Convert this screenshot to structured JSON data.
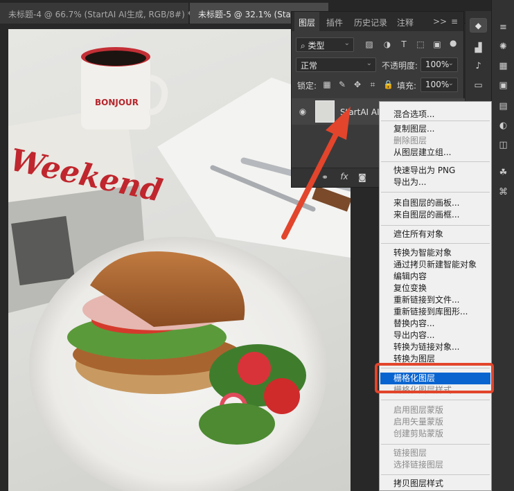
{
  "doc_tabs": [
    {
      "label": "未标题-4 @ 66.7% (StartAI AI生成, RGB/8#) *",
      "close": "×"
    },
    {
      "label": "未标题-5 @ 32.1% (StartAI"
    }
  ],
  "layers_panel": {
    "tabs": [
      "图层",
      "插件",
      "历史记录",
      "注释"
    ],
    "more": ">>",
    "filter": "类型",
    "blend_mode": "正常",
    "opacity_label": "不透明度:",
    "opacity_value": "100%",
    "lock_label": "锁定:",
    "fill_label": "填充:",
    "fill_value": "100%",
    "layer_name": "StartAI AI生",
    "footer_fx": "fx"
  },
  "context_menu": {
    "items": [
      {
        "label": "混合选项...",
        "enabled": true
      },
      {
        "label": "复制图层...",
        "enabled": true
      },
      {
        "label": "删除图层",
        "enabled": false
      },
      {
        "label": "从图层建立组...",
        "enabled": true
      },
      {
        "label": "快速导出为 PNG",
        "enabled": true
      },
      {
        "label": "导出为...",
        "enabled": true
      },
      {
        "label": "来自图层的画板...",
        "enabled": true
      },
      {
        "label": "来自图层的画框...",
        "enabled": true
      },
      {
        "label": "遮住所有对象",
        "enabled": true
      },
      {
        "label": "转换为智能对象",
        "enabled": true
      },
      {
        "label": "通过拷贝新建智能对象",
        "enabled": true
      },
      {
        "label": "编辑内容",
        "enabled": true
      },
      {
        "label": "复位变换",
        "enabled": true
      },
      {
        "label": "重新链接到文件...",
        "enabled": true
      },
      {
        "label": "重新链接到库图形...",
        "enabled": true
      },
      {
        "label": "替换内容...",
        "enabled": true
      },
      {
        "label": "导出内容...",
        "enabled": true
      },
      {
        "label": "转换为链接对象...",
        "enabled": true
      },
      {
        "label": "转换为图层",
        "enabled": true
      },
      {
        "label": "栅格化图层",
        "enabled": true,
        "highlighted": true
      },
      {
        "label": "栅格化图层样式",
        "enabled": false
      },
      {
        "label": "启用图层蒙版",
        "enabled": false
      },
      {
        "label": "启用矢量蒙版",
        "enabled": false
      },
      {
        "label": "创建剪贴蒙版",
        "enabled": false
      },
      {
        "label": "链接图层",
        "enabled": false
      },
      {
        "label": "选择链接图层",
        "enabled": false
      },
      {
        "label": "拷贝图层样式",
        "enabled": true
      }
    ]
  },
  "photo": {
    "mug_text": "BONJOUR",
    "newspaper_text": "Weekend"
  },
  "colors": {
    "highlight": "#0a64d0",
    "annotation": "#e2452c"
  }
}
